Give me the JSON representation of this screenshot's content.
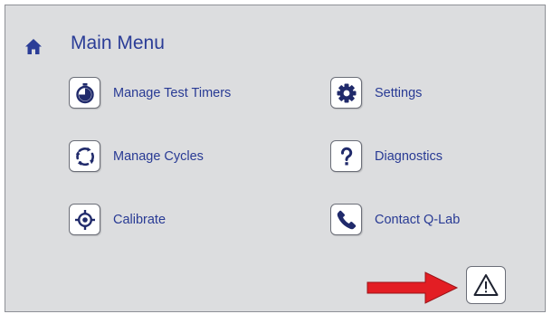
{
  "header": {
    "title": "Main Menu",
    "home_icon": "home-icon"
  },
  "menu": {
    "left": [
      {
        "label": "Manage Test Timers",
        "icon": "timer-icon"
      },
      {
        "label": "Manage Cycles",
        "icon": "cycle-icon"
      },
      {
        "label": "Calibrate",
        "icon": "crosshair-icon"
      }
    ],
    "right": [
      {
        "label": "Settings",
        "icon": "gear-icon"
      },
      {
        "label": "Diagnostics",
        "icon": "question-icon"
      },
      {
        "label": "Contact Q-Lab",
        "icon": "phone-icon"
      }
    ]
  },
  "alert": {
    "icon": "warning-icon"
  },
  "annotation": {
    "icon": "red-arrow-icon",
    "color": "#e31e24"
  },
  "colors": {
    "accent": "#2b3d97",
    "panel": "#dcdddf",
    "icon": "#202a6b"
  }
}
